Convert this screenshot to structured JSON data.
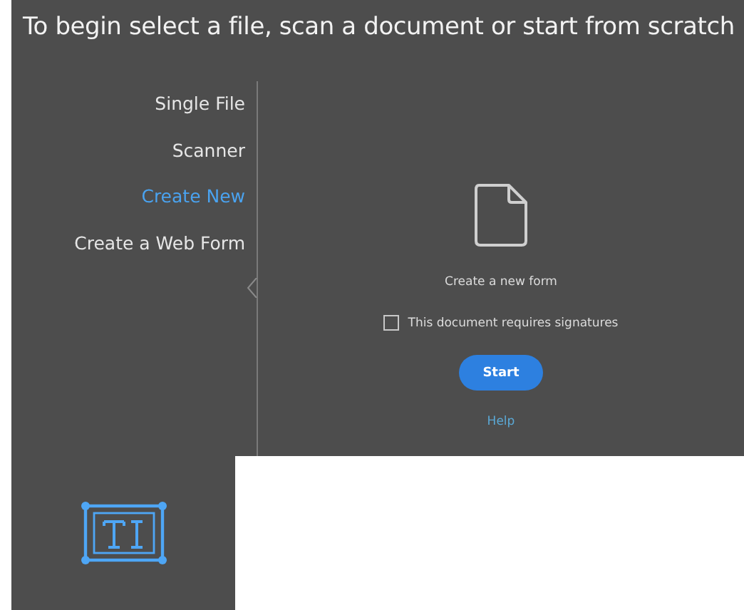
{
  "heading": "To begin select a file, scan a document or start from scratch",
  "sidebar": {
    "items": [
      {
        "label": "Single File",
        "selected": false
      },
      {
        "label": "Scanner",
        "selected": false
      },
      {
        "label": "Create New",
        "selected": true
      },
      {
        "label": "Create a Web Form",
        "selected": false
      }
    ]
  },
  "content": {
    "caption": "Create a new form",
    "checkbox": {
      "label": "This document requires signatures",
      "checked": false
    },
    "button": "Start",
    "link": "Help"
  }
}
